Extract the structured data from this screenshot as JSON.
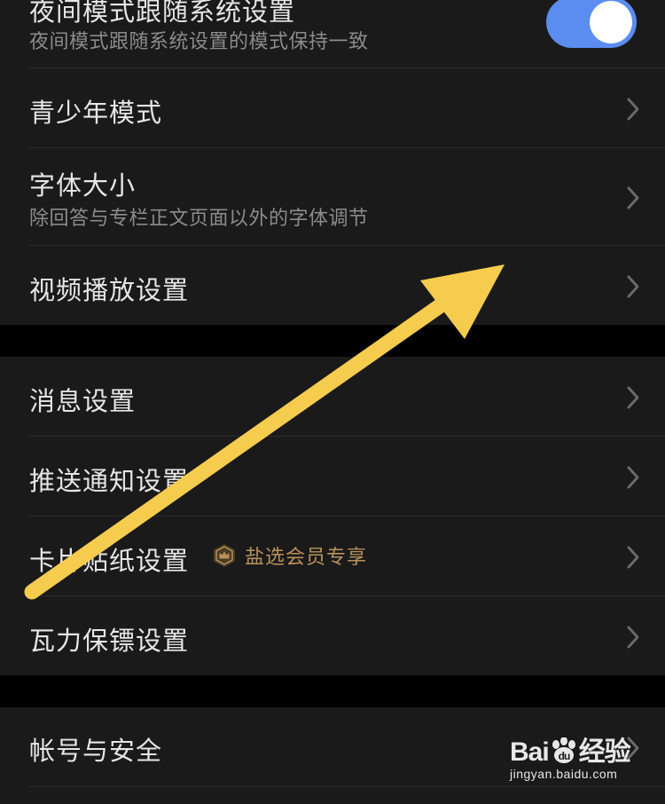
{
  "settings": {
    "dark_mode_follow": {
      "title": "夜间模式跟随系统设置",
      "subtitle": "夜间模式跟随系统设置的模式保持一致",
      "enabled": true
    },
    "youth_mode": {
      "title": "青少年模式"
    },
    "font_size": {
      "title": "字体大小",
      "subtitle": "除回答与专栏正文页面以外的字体调节"
    },
    "video_playback": {
      "title": "视频播放设置"
    },
    "messages": {
      "title": "消息设置"
    },
    "push": {
      "title": "推送通知设置"
    },
    "card_sticker": {
      "title": "卡片贴纸设置",
      "badge": "盐选会员专享",
      "badge_color": "#b8925a"
    },
    "guardian": {
      "title": "瓦力保镖设置"
    },
    "account": {
      "title": "帐号与安全"
    }
  },
  "watermark": {
    "brand": "Bai",
    "brand_suffix": "经验",
    "url": "jingyan.baidu.com"
  },
  "colors": {
    "background": "#000000",
    "row_background": "#1a1a1a",
    "toggle_on": "#5b8cf0",
    "annotation_arrow": "#f6cc4f"
  }
}
